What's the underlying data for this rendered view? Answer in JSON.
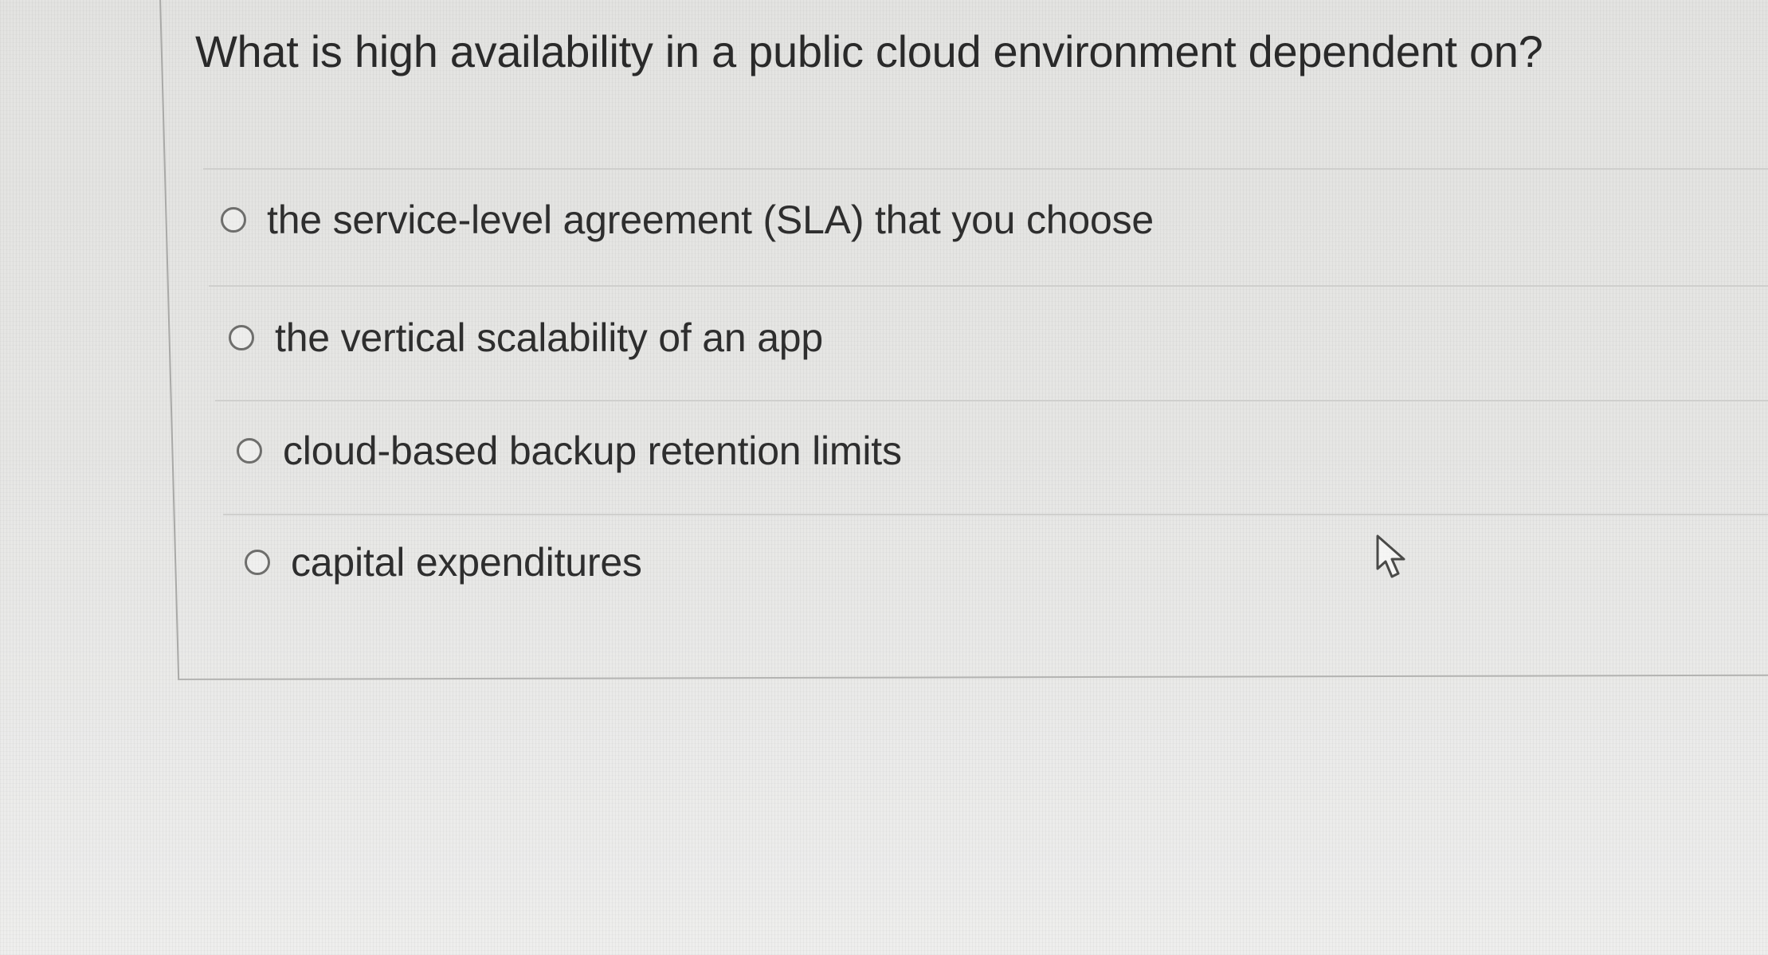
{
  "question": {
    "text": "What is high availability in a public cloud environment dependent on?"
  },
  "options": [
    {
      "label": "the service-level agreement (SLA) that you choose",
      "selected": false
    },
    {
      "label": "the vertical scalability of an app",
      "selected": false
    },
    {
      "label": "cloud-based backup retention limits",
      "selected": false
    },
    {
      "label": "capital expenditures",
      "selected": false
    }
  ],
  "icons": {
    "radio": "radio-button-icon",
    "cursor": "mouse-pointer-icon"
  },
  "colors": {
    "text": "#2e2e2e",
    "background": "#e6e6e4",
    "divider": "#cfcfcd",
    "radio_border": "#6e6e6c"
  }
}
